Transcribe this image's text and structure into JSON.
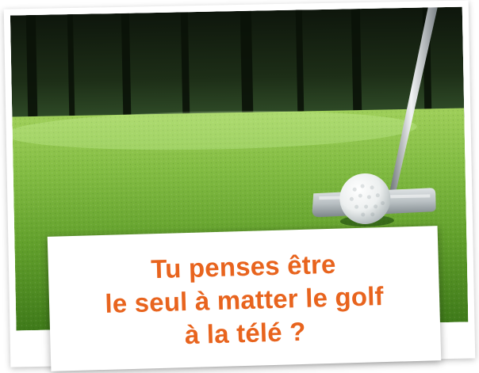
{
  "caption": {
    "line1": "Tu penses être",
    "line2": "le seul à matter le golf",
    "line3": "à la télé ?"
  },
  "colors": {
    "caption_text": "#e8641e",
    "card_background": "#ffffff",
    "grass": "#6fa82e",
    "forest": "#1c2a18"
  },
  "icons": {
    "photo": "golf-putter-ball-photo"
  }
}
